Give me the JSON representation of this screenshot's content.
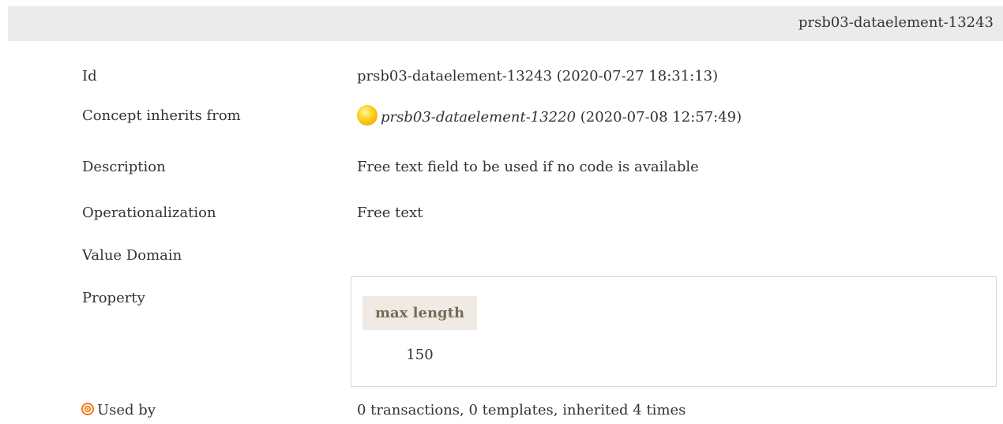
{
  "header": {
    "title": "prsb03-dataelement-13243"
  },
  "fields": {
    "id": {
      "label": "Id",
      "value": "prsb03-dataelement-13243 (2020-07-27 18:31:13)"
    },
    "inherits": {
      "label": "Concept inherits from",
      "link": "prsb03-dataelement-13220",
      "date": " (2020-07-08 12:57:49)",
      "icon": "yellow-ball-icon"
    },
    "description": {
      "label": "Description",
      "value": "Free text field to be used if no code is available"
    },
    "operationalization": {
      "label": "Operationalization",
      "value": "Free text"
    },
    "value_domain": {
      "label": "Value Domain"
    },
    "property": {
      "label": "Property",
      "column_header": "max length",
      "column_value": "150"
    },
    "used_by": {
      "label": "Used by",
      "icon": "target-icon",
      "value": "0 transactions, 0 templates, inherited 4 times"
    }
  },
  "colors": {
    "header_bg": "#ebebeb",
    "prop_header_bg": "#efebe4",
    "prop_header_text": "#7a6a58",
    "target_icon": "#f07a10"
  }
}
